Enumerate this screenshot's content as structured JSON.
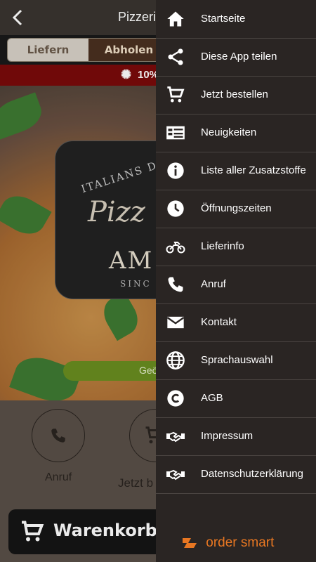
{
  "background_app": {
    "title": "Pizzeria",
    "segmented": {
      "delivery": "Liefern",
      "pickup": "Abholen"
    },
    "promo": "10%",
    "logo": {
      "arc": "ITALIANS DO",
      "name": "Pizz",
      "brand": "AM",
      "since": "SINC"
    },
    "pill_button": "Geö",
    "actions": [
      {
        "label": "Anruf",
        "icon": "phone-icon"
      },
      {
        "label": "Jetzt b",
        "icon": "cart-icon"
      }
    ],
    "cart_button": "Warenkorb"
  },
  "menu": {
    "items": [
      {
        "label": "Startseite",
        "icon": "home-icon"
      },
      {
        "label": "Diese App teilen",
        "icon": "share-icon"
      },
      {
        "label": "Jetzt bestellen",
        "icon": "cart-icon"
      },
      {
        "label": "Neuigkeiten",
        "icon": "news-icon"
      },
      {
        "label": "Liste aller Zusatzstoffe",
        "icon": "info-icon"
      },
      {
        "label": "Öffnungszeiten",
        "icon": "clock-icon"
      },
      {
        "label": "Lieferinfo",
        "icon": "motorcycle-icon"
      },
      {
        "label": "Anruf",
        "icon": "phone-icon"
      },
      {
        "label": "Kontakt",
        "icon": "mail-icon"
      },
      {
        "label": "Sprachauswahl",
        "icon": "globe-icon"
      },
      {
        "label": "AGB",
        "icon": "copyright-icon"
      },
      {
        "label": "Impressum",
        "icon": "handshake-icon"
      },
      {
        "label": "Datenschutzerklärung",
        "icon": "handshake-icon"
      }
    ],
    "brand": "order smart",
    "brand_color": "#e87722"
  }
}
